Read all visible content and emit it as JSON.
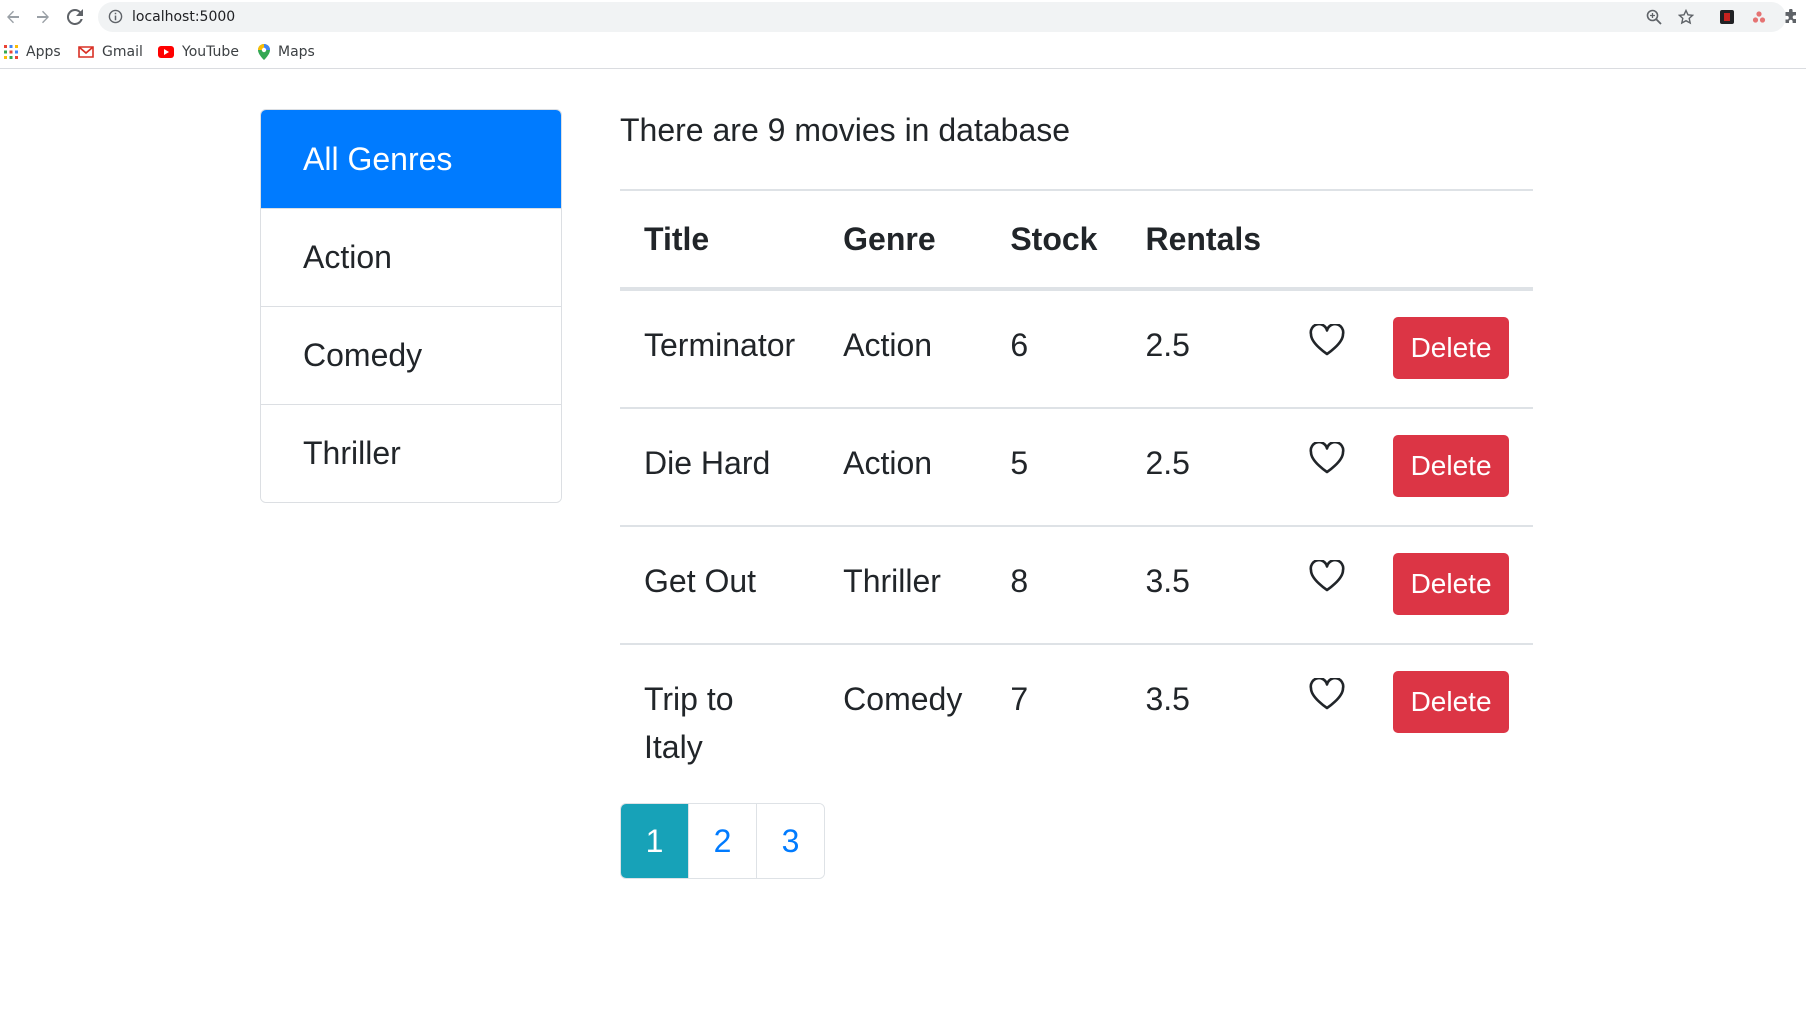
{
  "browser": {
    "url": "localhost:5000",
    "bookmarks": [
      {
        "label": "Apps",
        "icon": "apps-grid-icon"
      },
      {
        "label": "Gmail",
        "icon": "gmail-icon"
      },
      {
        "label": "YouTube",
        "icon": "youtube-icon"
      },
      {
        "label": "Maps",
        "icon": "maps-pin-icon"
      }
    ]
  },
  "sidebar": {
    "items": [
      {
        "label": "All Genres",
        "active": true
      },
      {
        "label": "Action",
        "active": false
      },
      {
        "label": "Comedy",
        "active": false
      },
      {
        "label": "Thriller",
        "active": false
      }
    ]
  },
  "main": {
    "count_text": "There are 9 movies in database",
    "columns": [
      "Title",
      "Genre",
      "Stock",
      "Rentals"
    ],
    "rows": [
      {
        "title": "Terminator",
        "genre": "Action",
        "stock": "6",
        "rentals": "2.5",
        "delete_label": "Delete"
      },
      {
        "title": "Die Hard",
        "genre": "Action",
        "stock": "5",
        "rentals": "2.5",
        "delete_label": "Delete"
      },
      {
        "title": "Get Out",
        "genre": "Thriller",
        "stock": "8",
        "rentals": "3.5",
        "delete_label": "Delete"
      },
      {
        "title": "Trip to Italy",
        "genre": "Comedy",
        "stock": "7",
        "rentals": "3.5",
        "delete_label": "Delete"
      }
    ],
    "pagination": [
      "1",
      "2",
      "3"
    ],
    "active_page": "1"
  },
  "colors": {
    "primary": "#007bff",
    "danger": "#dc3545",
    "info": "#17a2b8"
  }
}
